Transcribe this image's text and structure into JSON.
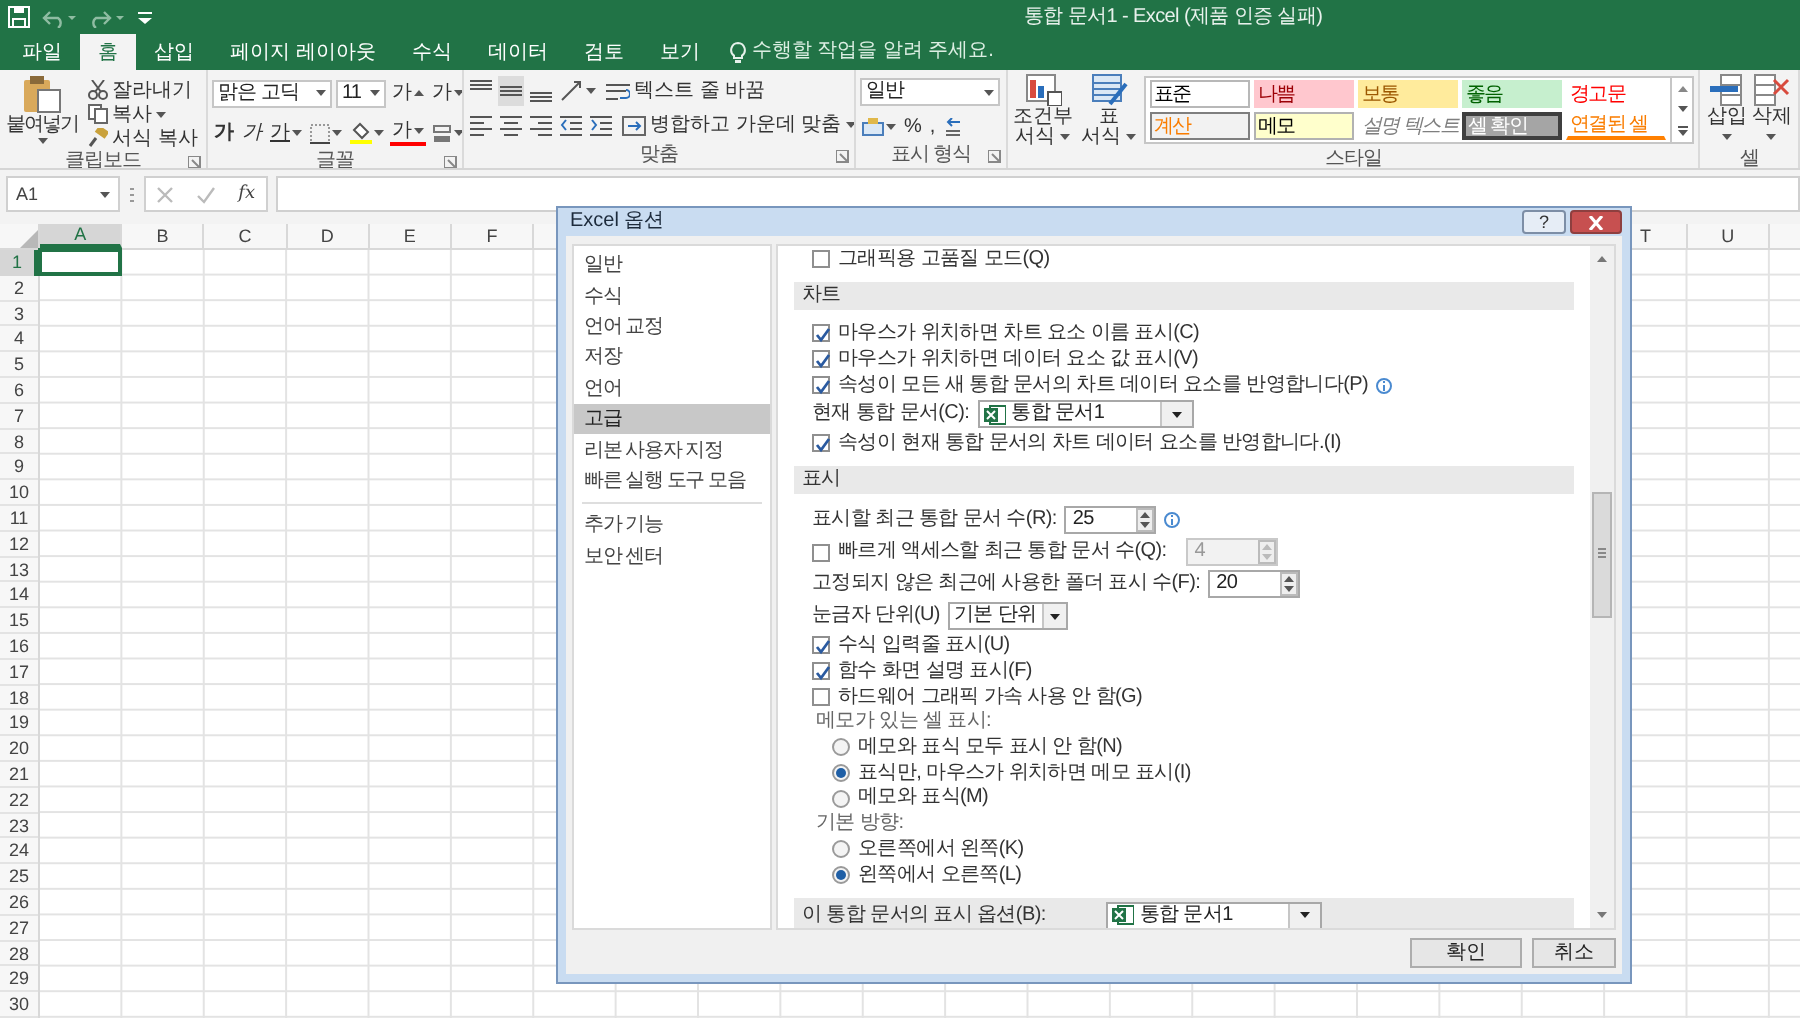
{
  "title_bar": {
    "title": "통합 문서1 - Excel (제품 인증 실패)"
  },
  "ribbon_tabs": [
    {
      "label": "파일",
      "selected": false
    },
    {
      "label": "홈",
      "selected": true
    },
    {
      "label": "삽입",
      "selected": false
    },
    {
      "label": "페이지 레이아웃",
      "selected": false
    },
    {
      "label": "수식",
      "selected": false
    },
    {
      "label": "데이터",
      "selected": false
    },
    {
      "label": "검토",
      "selected": false
    },
    {
      "label": "보기",
      "selected": false
    }
  ],
  "tell_me": {
    "placeholder": "수행할 작업을 알려 주세요."
  },
  "ribbon": {
    "clipboard": {
      "label": "클립보드",
      "paste": "붙여넣기",
      "cut": "잘라내기",
      "copy": "복사",
      "format_painter": "서식 복사"
    },
    "font": {
      "label": "글꼴",
      "font_name": "맑은 고딕",
      "font_size": "11",
      "grow": "가",
      "shrink": "가",
      "bold": "가",
      "italic": "가",
      "underline": "가",
      "font_color": "가"
    },
    "alignment": {
      "label": "맞춤",
      "wrap_text": "텍스트 줄 바꿈",
      "merge_center": "병합하고 가운데 맞춤"
    },
    "number": {
      "label": "표시 형식",
      "format": "일반",
      "percent": "%",
      "comma": ","
    },
    "styles": {
      "label": "스타일",
      "conditional": "조건부 서식",
      "table": "표 서식",
      "cell_styles": [
        {
          "label": "표준",
          "kind": "normal"
        },
        {
          "label": "나쁨",
          "kind": "bad"
        },
        {
          "label": "보통",
          "kind": "neutral"
        },
        {
          "label": "좋음",
          "kind": "good"
        },
        {
          "label": "경고문",
          "kind": "warning"
        },
        {
          "label": "계산",
          "kind": "calculation"
        },
        {
          "label": "메모",
          "kind": "note"
        },
        {
          "label": "설명 텍스트",
          "kind": "explanatory"
        },
        {
          "label": "셀 확인",
          "kind": "check"
        },
        {
          "label": "연결된 셀",
          "kind": "linked"
        }
      ]
    },
    "cells": {
      "label": "셀",
      "insert": "삽입",
      "delete": "삭제"
    }
  },
  "formula_bar": {
    "name_box": "A1",
    "function_label": "fx"
  },
  "sheet": {
    "columns_left": [
      {
        "label": "A",
        "selected": true
      },
      {
        "label": "B",
        "selected": false
      },
      {
        "label": "C",
        "selected": false
      },
      {
        "label": "D",
        "selected": false
      },
      {
        "label": "E",
        "selected": false
      },
      {
        "label": "F",
        "selected": false
      }
    ],
    "columns_right": [
      {
        "label": "T",
        "selected": false
      },
      {
        "label": "U",
        "selected": false
      }
    ],
    "rows": [
      {
        "label": "1",
        "selected": true
      },
      {
        "label": "2",
        "selected": false
      },
      {
        "label": "3",
        "selected": false
      },
      {
        "label": "4",
        "selected": false
      },
      {
        "label": "5",
        "selected": false
      },
      {
        "label": "6",
        "selected": false
      },
      {
        "label": "7",
        "selected": false
      },
      {
        "label": "8",
        "selected": false
      },
      {
        "label": "9",
        "selected": false
      },
      {
        "label": "10",
        "selected": false
      },
      {
        "label": "11",
        "selected": false
      },
      {
        "label": "12",
        "selected": false
      },
      {
        "label": "13",
        "selected": false
      },
      {
        "label": "14",
        "selected": false
      },
      {
        "label": "15",
        "selected": false
      },
      {
        "label": "16",
        "selected": false
      },
      {
        "label": "17",
        "selected": false
      },
      {
        "label": "18",
        "selected": false
      },
      {
        "label": "19",
        "selected": false
      },
      {
        "label": "20",
        "selected": false
      },
      {
        "label": "21",
        "selected": false
      },
      {
        "label": "22",
        "selected": false
      },
      {
        "label": "23",
        "selected": false
      },
      {
        "label": "24",
        "selected": false
      },
      {
        "label": "25",
        "selected": false
      },
      {
        "label": "26",
        "selected": false
      },
      {
        "label": "27",
        "selected": false
      },
      {
        "label": "28",
        "selected": false
      },
      {
        "label": "29",
        "selected": false
      },
      {
        "label": "30",
        "selected": false
      }
    ]
  },
  "dialog": {
    "title": "Excel 옵션",
    "help": "?",
    "nav_sections": [
      {
        "items": [
          {
            "label": "일반",
            "selected": false
          },
          {
            "label": "수식",
            "selected": false
          },
          {
            "label": "언어 교정",
            "selected": false
          },
          {
            "label": "저장",
            "selected": false
          },
          {
            "label": "언어",
            "selected": false
          },
          {
            "label": "고급",
            "selected": true
          },
          {
            "label": "리본 사용자 지정",
            "selected": false
          },
          {
            "label": "빠른 실행 도구 모음",
            "selected": false
          }
        ]
      },
      {
        "items": [
          {
            "label": "추가 기능",
            "selected": false
          },
          {
            "label": "보안 센터",
            "selected": false
          }
        ]
      }
    ],
    "options": [
      {
        "kind": "checkbox",
        "label": "그래픽용 고품질 모드(Q)",
        "checked": false
      },
      {
        "kind": "header",
        "label": "차트"
      },
      {
        "kind": "checkbox",
        "label": "마우스가 위치하면 차트 요소 이름 표시(C)",
        "checked": true
      },
      {
        "kind": "checkbox",
        "label": "마우스가 위치하면 데이터 요소 값 표시(V)",
        "checked": true
      },
      {
        "kind": "checkbox",
        "label": "속성이 모든 새 통합 문서의 차트 데이터 요소를 반영합니다(P)",
        "checked": true,
        "info": true
      },
      {
        "kind": "workbook_select",
        "label": "현재 통합 문서(C):",
        "value": "통합 문서1"
      },
      {
        "kind": "checkbox",
        "label": "속성이 현재 통합 문서의 차트 데이터 요소를 반영합니다.(I)",
        "checked": true
      },
      {
        "kind": "header",
        "label": "표시"
      },
      {
        "kind": "spin",
        "label": "표시할 최근 통합 문서 수(R):",
        "value": "25",
        "info": true
      },
      {
        "kind": "checkbox_spin",
        "label": "빠르게 액세스할 최근 통합 문서 수(Q):",
        "checked": false,
        "value": "4",
        "disabled": true
      },
      {
        "kind": "spin",
        "label": "고정되지 않은 최근에 사용한 폴더 표시 수(F):",
        "value": "20"
      },
      {
        "kind": "select",
        "label": "눈금자 단위(U)",
        "value": "기본 단위"
      },
      {
        "kind": "checkbox",
        "label": "수식 입력줄 표시(U)",
        "checked": true
      },
      {
        "kind": "checkbox",
        "label": "함수 화면 설명 표시(F)",
        "checked": true
      },
      {
        "kind": "checkbox",
        "label": "하드웨어 그래픽 가속 사용 안 함(G)",
        "checked": false
      },
      {
        "kind": "label",
        "label": "메모가 있는 셀 표시:"
      },
      {
        "kind": "radio",
        "label": "메모와 표식 모두 표시 안 함(N)",
        "selected": false
      },
      {
        "kind": "radio",
        "label": "표식만, 마우스가 위치하면 메모 표시(I)",
        "selected": true
      },
      {
        "kind": "radio",
        "label": "메모와 표식(M)",
        "selected": false
      },
      {
        "kind": "label",
        "label": "기본 방향:"
      },
      {
        "kind": "radio",
        "label": "오른쪽에서 왼쪽(K)",
        "selected": false
      },
      {
        "kind": "radio",
        "label": "왼쪽에서 오른쪽(L)",
        "selected": true
      },
      {
        "kind": "header_select",
        "label": "이 통합 문서의 표시 옵션(B):",
        "value": "통합 문서1"
      }
    ],
    "buttons": [
      {
        "label": "확인"
      },
      {
        "label": "취소"
      }
    ]
  }
}
